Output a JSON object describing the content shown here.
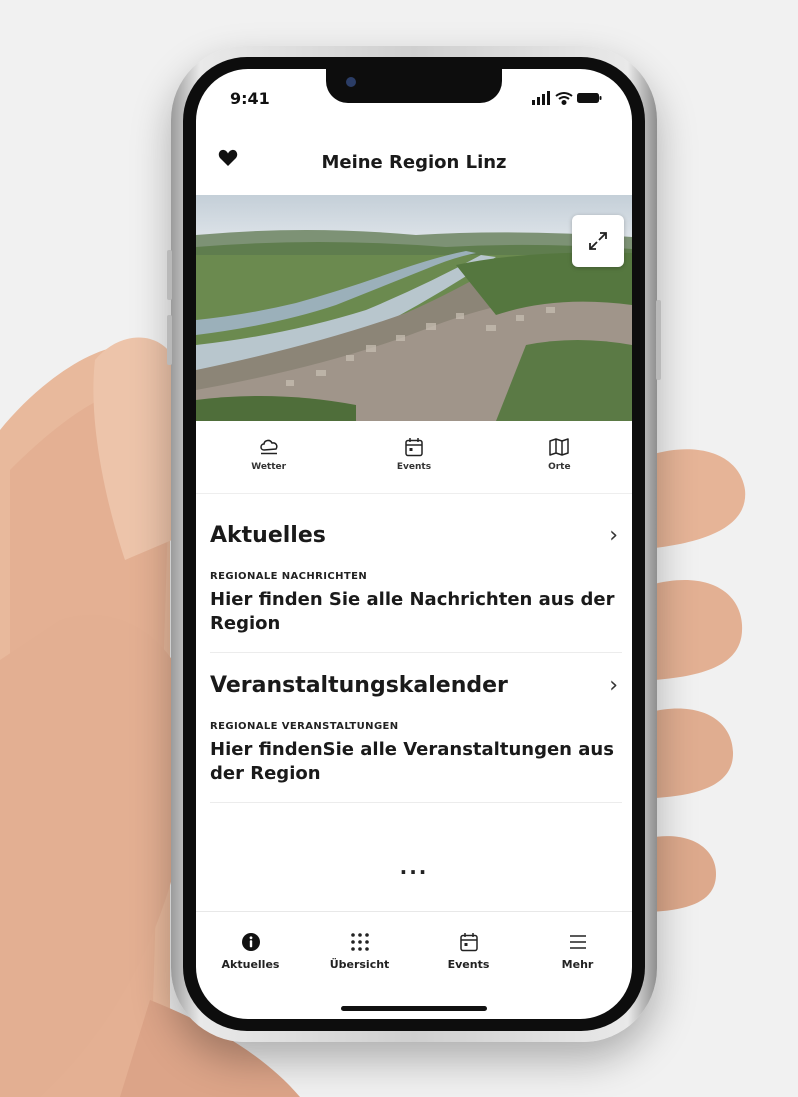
{
  "status_bar": {
    "time": "9:41"
  },
  "header": {
    "title": "Meine Region Linz",
    "favorite_icon": "heart-icon"
  },
  "hero": {
    "expand_icon": "expand-icon"
  },
  "quick_nav": [
    {
      "label": "Wetter",
      "icon": "cloud-icon"
    },
    {
      "label": "Events",
      "icon": "calendar-icon"
    },
    {
      "label": "Orte",
      "icon": "map-icon"
    }
  ],
  "sections": [
    {
      "title": "Aktuelles",
      "chevron": "›",
      "overline": "REGIONALE NACHRICHTEN",
      "headline": "Hier finden Sie alle Nachrichten aus der Region"
    },
    {
      "title": "Veranstaltungskalender",
      "chevron": "›",
      "overline": "REGIONALE VERANSTALTUNGEN",
      "headline": "Hier findenSie alle Veranstaltungen aus der Region"
    }
  ],
  "more": "...",
  "tab_bar": [
    {
      "label": "Aktuelles",
      "icon": "info-icon"
    },
    {
      "label": "Übersicht",
      "icon": "grid-icon"
    },
    {
      "label": "Events",
      "icon": "calendar-icon"
    },
    {
      "label": "Mehr",
      "icon": "menu-icon"
    }
  ],
  "colors": {
    "text": "#1a1a1a",
    "accent": "#111111",
    "background": "#ffffff"
  }
}
